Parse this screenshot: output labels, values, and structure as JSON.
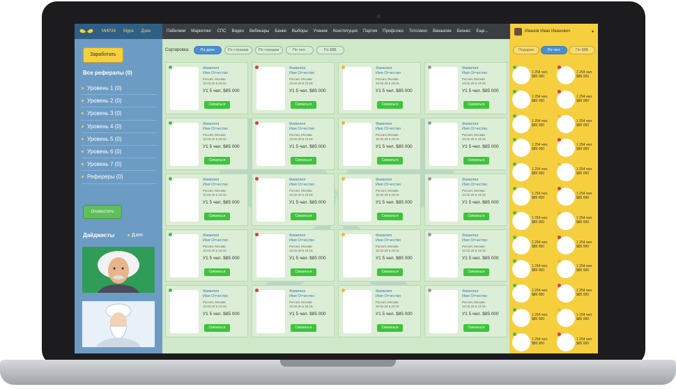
{
  "topbar": {
    "brand": "МИР24",
    "links_left": [
      "Мура",
      "Дзен"
    ],
    "nav": [
      "Пабилики",
      "Маркетинг",
      "СПС",
      "Видео",
      "Вебинары",
      "Банки",
      "Выборы",
      "Учение",
      "Конституция",
      "Партия",
      "Профсоюз",
      "Тотсомол",
      "Вакансии",
      "Бизнес",
      "Еще..."
    ],
    "user_name": "Иванов Иван Иванович"
  },
  "sidebar": {
    "earn_button": "Заработать",
    "referrals_title": "Все рефералы (0)",
    "levels": [
      "Уровень 1 (0)",
      "Уровень 2 (0)",
      "Уровень 3 (0)",
      "Уровень 4 (0)",
      "Уровень 5 (0)",
      "Уровень 6 (0)",
      "Уровень 7 (0)",
      "Рефереры (0)"
    ],
    "notify_button": "Оповестить",
    "digests_title": "Дайджесты",
    "digests_sub": "Дзен"
  },
  "sort": {
    "label": "Сортировка:",
    "options": [
      "По дате",
      "По странам",
      "По городам",
      "По чел.",
      "По $$$"
    ],
    "active": 0
  },
  "card": {
    "name_line1": "Фамилия",
    "name_line2": "Имя Отчество",
    "loc_line1": "Россия, Москва",
    "loc_line2": "10.02.20 в 23:16",
    "stat": "У1 5 чел. $85 000",
    "button": "Связаться"
  },
  "card_dots": [
    "#3cc43a",
    "#e03a3a",
    "#f0b92a",
    "#999999",
    "#3cc43a",
    "#e03a3a",
    "#f0b92a",
    "#999999",
    "#3cc43a",
    "#e03a3a",
    "#f0b92a",
    "#999999",
    "#3cc43a",
    "#e03a3a",
    "#f0b92a",
    "#999999",
    "#3cc43a",
    "#e03a3a",
    "#f0b92a",
    "#999999"
  ],
  "right": {
    "pills": [
      "Подарки",
      "По чел.",
      "По $$$"
    ],
    "active": 1,
    "item_line1": "1 254 чел.",
    "item_line2": "$85 000",
    "dots": [
      "#3cc43a",
      "#e03a3a",
      "#3cc43a",
      "#e03a3a",
      "#3cc43a",
      "#f0b92a",
      "#3cc43a",
      "#e03a3a",
      "#3cc43a",
      "#f0b92a",
      "#3cc43a",
      "#e03a3a",
      "#3cc43a",
      "#f0b92a",
      "#3cc43a",
      "#e03a3a",
      "#3cc43a",
      "#f0b92a",
      "#3cc43a",
      "#e03a3a",
      "#3cc43a",
      "#f0b92a",
      "#3cc43a",
      "#e03a3a"
    ]
  },
  "colors": {
    "accent_yellow": "#f6cf3f",
    "sidebar_blue": "#6c9cc4",
    "main_green": "#cfe8c8",
    "button_green": "#3cc43a",
    "link_blue": "#3a7ab8"
  }
}
